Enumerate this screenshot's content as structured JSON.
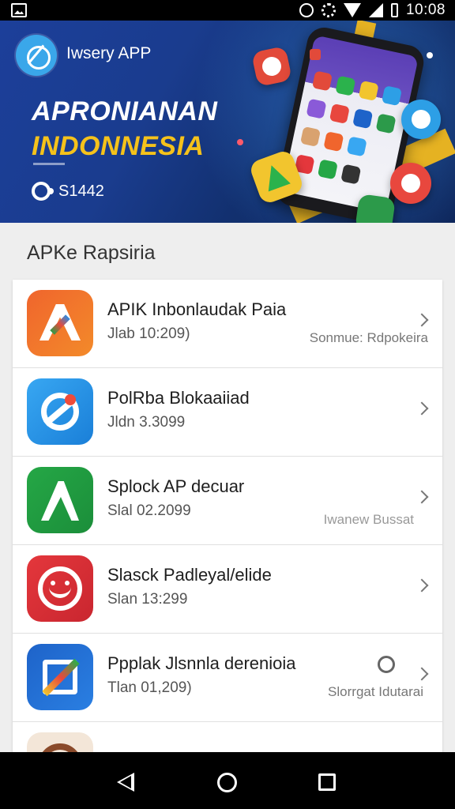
{
  "status_bar": {
    "time": "10:08"
  },
  "banner": {
    "app_name": "Iwsery APP",
    "headline_line1": "APRONIANAN",
    "headline_line2": "INDONNESIA",
    "downloads": "S1442"
  },
  "section": {
    "title": "APKe Rapsiria"
  },
  "apps": [
    {
      "title": "APIK Inbonlaudak Paia",
      "subtitle": "Jlab 10:209)",
      "extra": "Sonmue: Rdpokeira",
      "icon": "orange-a-logo"
    },
    {
      "title": "PolRba Blokaaiiad",
      "subtitle": "Jldn 3.3099",
      "extra": "",
      "icon": "blue-ring-logo"
    },
    {
      "title": "Splock AP decuar",
      "subtitle": "Slal 02.2099",
      "extra": "Iwanew Bussat",
      "icon": "green-arrow-logo"
    },
    {
      "title": "Slasck Padleyal/elide",
      "subtitle": "Slan 13:299",
      "extra": "",
      "icon": "red-smile-logo"
    },
    {
      "title": "Ppplak Jlsnnla derenioia",
      "subtitle": "Tlan 01,209)",
      "extra": "Slorrgat Idutarai",
      "icon": "multicolor-square-logo"
    }
  ],
  "colors": {
    "banner_bg": "#1a3c8e",
    "headline_accent": "#f5c21b",
    "list_bg": "#ffffff",
    "page_bg": "#eeeeee"
  }
}
